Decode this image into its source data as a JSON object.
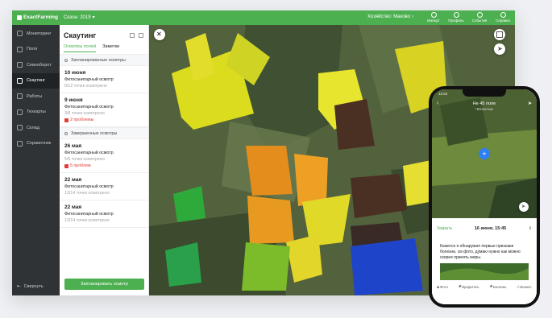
{
  "app": {
    "logo": "ExactFarming"
  },
  "topbar": {
    "season": "Сезон: 2019",
    "farm": "Хозяйство: Маково",
    "buttons": [
      {
        "label": "Импорт",
        "icon": "upload-icon"
      },
      {
        "label": "Профиль",
        "icon": "user-icon"
      },
      {
        "label": "События",
        "icon": "bell-icon"
      },
      {
        "label": "Справка",
        "icon": "help-icon"
      }
    ]
  },
  "sidebar": {
    "items": [
      {
        "label": "Мониторинг",
        "icon": "monitor-icon"
      },
      {
        "label": "Поля",
        "icon": "fields-icon"
      },
      {
        "label": "Севооборот",
        "icon": "rotation-icon"
      },
      {
        "label": "Скаутинг",
        "icon": "scouting-icon",
        "active": true
      },
      {
        "label": "Работы",
        "icon": "works-icon"
      },
      {
        "label": "Техкарты",
        "icon": "techmap-icon"
      },
      {
        "label": "Склад",
        "icon": "warehouse-icon"
      },
      {
        "label": "Справочник",
        "icon": "book-icon"
      }
    ],
    "collapse": "Свернуть"
  },
  "panel": {
    "title": "Скаутинг",
    "tabs": [
      "Осмотры полей",
      "Заметки"
    ],
    "group_planned": "Запланированные осмотры",
    "group_done": "Завершенные осмотры",
    "planned": [
      {
        "date": "10 июня",
        "type": "Фитосанитарный осмотр",
        "progress": "0/12 точек осмотрено",
        "problems": ""
      },
      {
        "date": "9 июня",
        "type": "Фитосанитарный осмотр",
        "progress": "3/8 точек осмотрено",
        "problems": "2 проблемы"
      }
    ],
    "done": [
      {
        "date": "26 мая",
        "type": "Фитосанитарный осмотр",
        "progress": "5/5 точек осмотрено",
        "problems": "5 проблем"
      },
      {
        "date": "22 мая",
        "type": "Фитосанитарный осмотр",
        "progress": "13/14 точек осмотрено",
        "problems": ""
      },
      {
        "date": "22 мая",
        "type": "Фитосанитарный осмотр",
        "progress": "13/14 точек осмотрено",
        "problems": ""
      }
    ],
    "plan_button": "Запланировать осмотр"
  },
  "phone": {
    "time": "12:24",
    "field_title": "Не 45 поле",
    "field_sub": "Чётностью",
    "close": "Закрыть",
    "date": "16 июня, 15:45",
    "note": "Кажется я обнаружил первые признаки болезни, см фото, думаю нужно как можно скорее принять меры.",
    "tags": [
      "Фото",
      "Вредитель",
      "Болезнь",
      "Бизнес"
    ]
  },
  "colors": {
    "brand": "#4caf50",
    "sidebar": "#2f3336",
    "problem": "#e53935"
  }
}
